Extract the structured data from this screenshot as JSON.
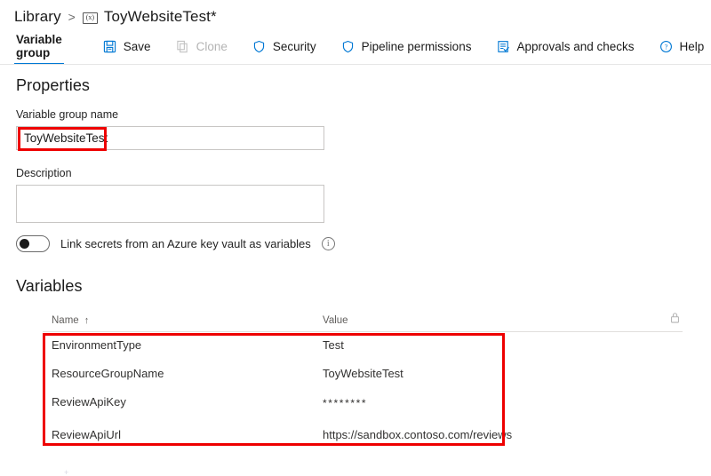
{
  "breadcrumb": {
    "root": "Library",
    "separator": ">",
    "icon": "variable-group-icon",
    "icon_glyph": "(x)",
    "current": "ToyWebsiteTest*"
  },
  "toolbar": {
    "tab_label": "Variable group",
    "buttons": [
      {
        "label": "Save",
        "icon": "save-icon",
        "enabled": true
      },
      {
        "label": "Clone",
        "icon": "clone-icon",
        "enabled": false
      },
      {
        "label": "Security",
        "icon": "shield-icon",
        "enabled": true
      },
      {
        "label": "Pipeline permissions",
        "icon": "shield-icon",
        "enabled": true
      },
      {
        "label": "Approvals and checks",
        "icon": "checklist-icon",
        "enabled": true
      },
      {
        "label": "Help",
        "icon": "help-circle-icon",
        "enabled": true
      }
    ]
  },
  "properties": {
    "heading": "Properties",
    "name_label": "Variable group name",
    "name_value": "ToyWebsiteTest",
    "name_placeholder": "",
    "description_label": "Description",
    "description_value": "",
    "description_placeholder": "",
    "keyvault_toggle_label": "Link secrets from an Azure key vault as variables",
    "keyvault_toggle_state": "off",
    "info_icon": "info-icon",
    "info_glyph": "i"
  },
  "variables": {
    "heading": "Variables",
    "columns": {
      "name": "Name",
      "value": "Value",
      "sort_indicator": "↑",
      "lock": "lock-icon"
    },
    "rows": [
      {
        "name": "EnvironmentType",
        "value": "Test",
        "secret": false
      },
      {
        "name": "ResourceGroupName",
        "value": "ToyWebsiteTest",
        "secret": false
      },
      {
        "name": "ReviewApiKey",
        "value": "********",
        "secret": true
      },
      {
        "name": "ReviewApiUrl",
        "value": "https://sandbox.contoso.com/reviews",
        "secret": false
      }
    ]
  },
  "annotations": {
    "highlight_color": "#ee0000",
    "boxes": [
      {
        "target": "variable-group-name-value"
      },
      {
        "target": "variables-table-rows"
      }
    ]
  }
}
